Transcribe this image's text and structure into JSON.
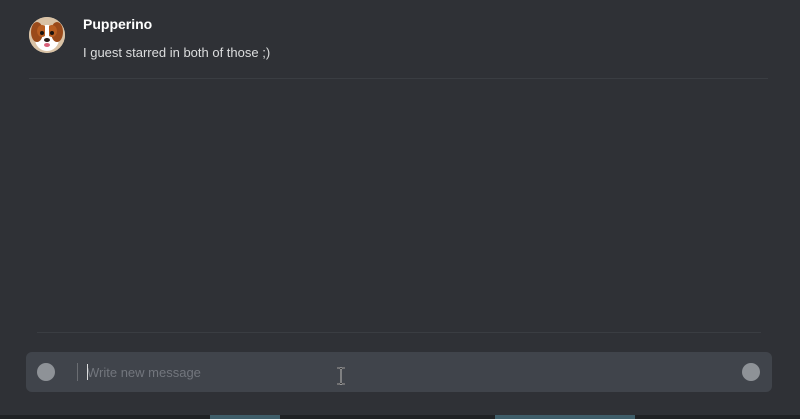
{
  "message": {
    "author": "Pupperino",
    "text": "I guest starred in both of those ;)"
  },
  "composer": {
    "placeholder": "Write new message"
  }
}
